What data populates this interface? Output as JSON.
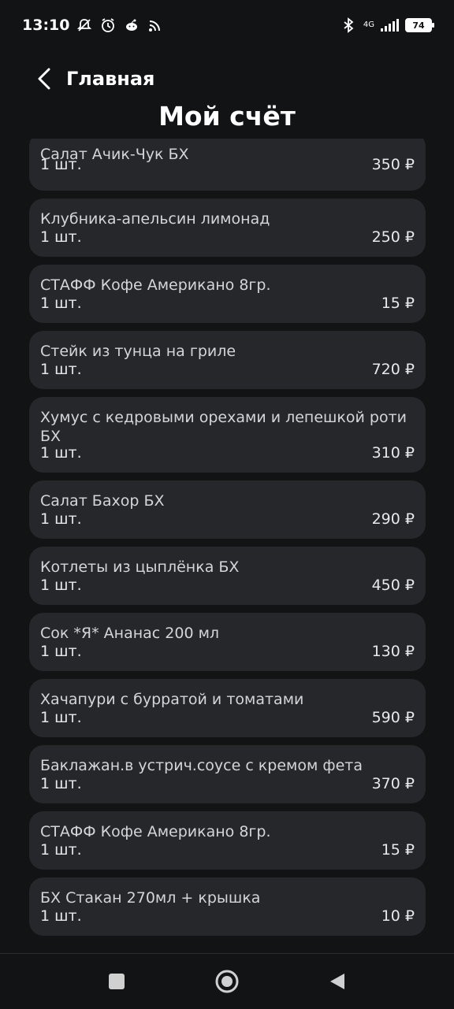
{
  "status_bar": {
    "time": "13:10",
    "network": "4G",
    "battery": "74",
    "icons": [
      "muted-bell-icon",
      "alarm-icon",
      "reddit-icon",
      "cast-icon",
      "bluetooth-icon",
      "signal-icon",
      "battery-icon"
    ]
  },
  "header": {
    "back_label": "Главная",
    "title": "Мой счёт"
  },
  "items": [
    {
      "name": "Салат Ачик-Чук БХ",
      "qty": "1 шт.",
      "price": "350 ₽"
    },
    {
      "name": "Клубника-апельсин лимонад",
      "qty": "1 шт.",
      "price": "250 ₽"
    },
    {
      "name": "СТАФФ Кофе Американо 8гр.",
      "qty": "1 шт.",
      "price": "15 ₽"
    },
    {
      "name": "Стейк из тунца на гриле",
      "qty": "1 шт.",
      "price": "720 ₽"
    },
    {
      "name": "Хумус с кедровыми орехами и лепешкой роти БХ",
      "qty": "1 шт.",
      "price": "310 ₽"
    },
    {
      "name": "Салат Бахор БХ",
      "qty": "1 шт.",
      "price": "290 ₽"
    },
    {
      "name": "Котлеты из цыплёнка БХ",
      "qty": "1 шт.",
      "price": "450 ₽"
    },
    {
      "name": "Сок *Я* Ананас 200 мл",
      "qty": "1 шт.",
      "price": "130 ₽"
    },
    {
      "name": "Хачапури с бурратой и томатами",
      "qty": "1 шт.",
      "price": "590 ₽"
    },
    {
      "name": "Баклажан.в устрич.соусе с кремом фета",
      "qty": "1 шт.",
      "price": "370 ₽"
    },
    {
      "name": "СТАФФ Кофе Американо 8гр.",
      "qty": "1 шт.",
      "price": "15 ₽"
    },
    {
      "name": "БХ Стакан 270мл + крышка",
      "qty": "1 шт.",
      "price": "10 ₽"
    }
  ],
  "nav_bar": {
    "icons": [
      "recents-square-icon",
      "home-circle-icon",
      "back-triangle-icon"
    ]
  },
  "colors": {
    "background": "#111315",
    "card": "#25272b",
    "text": "#ffffff",
    "muted_text": "#d4d5d8"
  }
}
